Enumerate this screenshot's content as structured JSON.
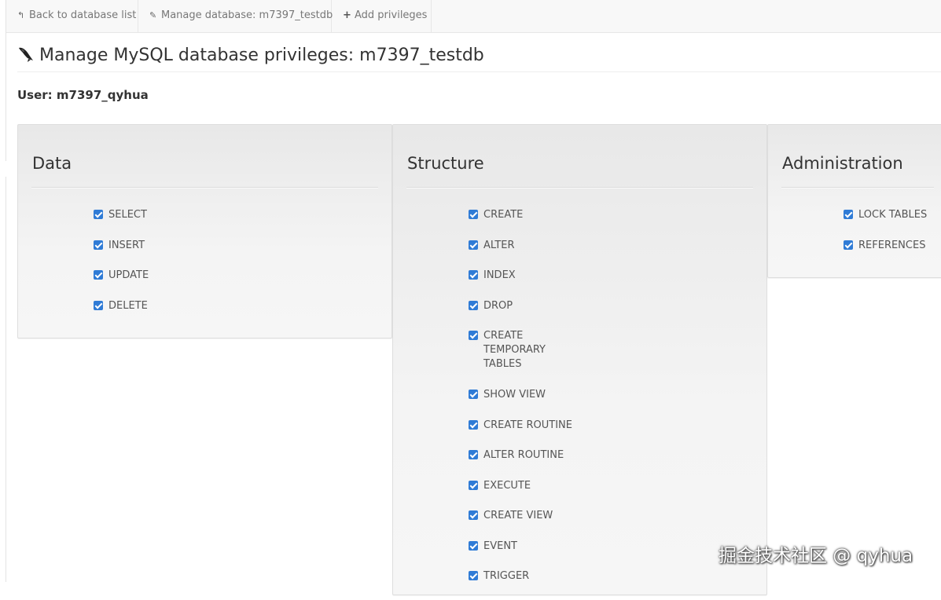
{
  "nav": {
    "items": [
      {
        "label": "Back to database list",
        "icon": "reply-icon"
      },
      {
        "label": "Manage database: m7397_testdb",
        "icon": "edit-icon"
      },
      {
        "label": "Add privileges",
        "icon": "plus-icon"
      }
    ]
  },
  "page": {
    "title": "Manage MySQL database privileges: m7397_testdb",
    "title_icon": "mysql-dolphin-icon",
    "user": "User: m7397_qyhua"
  },
  "panels": [
    {
      "title": "Data",
      "privileges": [
        {
          "label": "SELECT",
          "checked": true
        },
        {
          "label": "INSERT",
          "checked": true
        },
        {
          "label": "UPDATE",
          "checked": true
        },
        {
          "label": "DELETE",
          "checked": true
        }
      ]
    },
    {
      "title": "Structure",
      "privileges": [
        {
          "label": "CREATE",
          "checked": true
        },
        {
          "label": "ALTER",
          "checked": true
        },
        {
          "label": "INDEX",
          "checked": true
        },
        {
          "label": "DROP",
          "checked": true
        },
        {
          "label": "CREATE TEMPORARY TABLES",
          "checked": true
        },
        {
          "label": "SHOW VIEW",
          "checked": true
        },
        {
          "label": "CREATE ROUTINE",
          "checked": true
        },
        {
          "label": "ALTER ROUTINE",
          "checked": true
        },
        {
          "label": "EXECUTE",
          "checked": true
        },
        {
          "label": "CREATE VIEW",
          "checked": true
        },
        {
          "label": "EVENT",
          "checked": true
        },
        {
          "label": "TRIGGER",
          "checked": true
        }
      ]
    },
    {
      "title": "Administration",
      "privileges": [
        {
          "label": "LOCK TABLES",
          "checked": true
        },
        {
          "label": "REFERENCES",
          "checked": true
        }
      ]
    }
  ],
  "watermark": "掘金技术社区 @ qyhua",
  "colors": {
    "checkbox": "#2f7bd6",
    "navbar_bg": "#f8f8f8",
    "panel_bg": "#f2f2f2"
  }
}
